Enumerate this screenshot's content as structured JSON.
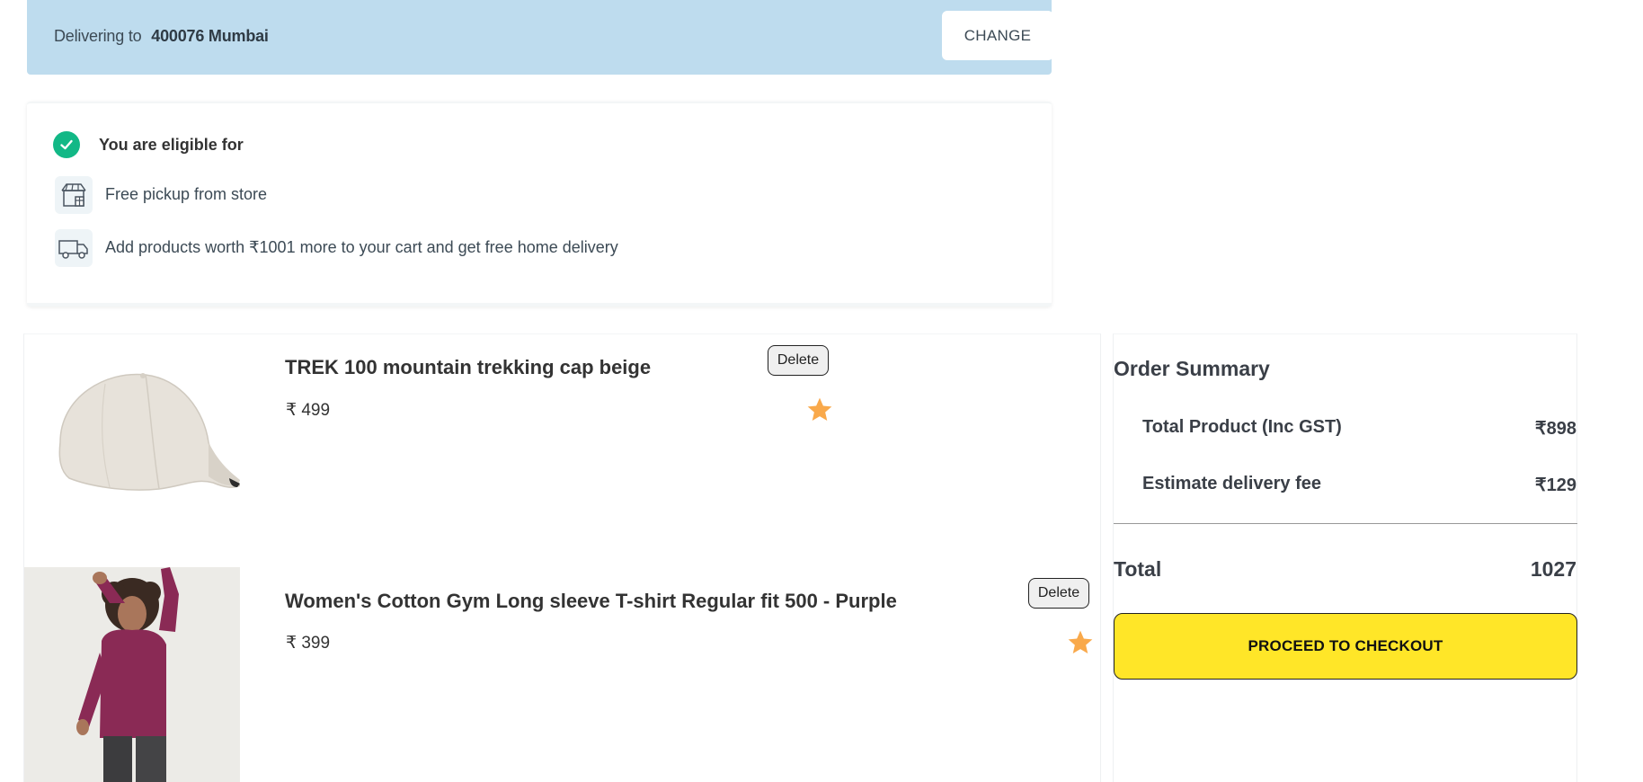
{
  "delivery": {
    "prefix": "Delivering to",
    "location": "400076 Mumbai",
    "change_label": "CHANGE"
  },
  "eligibility": {
    "title": "You are eligible for",
    "items": [
      {
        "icon": "store-pickup-icon",
        "text": "Free pickup from store"
      },
      {
        "icon": "delivery-truck-icon",
        "text": "Add products worth ₹1001 more to your cart and get free home delivery"
      }
    ]
  },
  "cart": {
    "items": [
      {
        "title": "TREK 100 mountain trekking cap beige",
        "price": "₹ 499",
        "delete_label": "Delete",
        "image_icon": "cap-image"
      },
      {
        "title": "Women's Cotton Gym Long sleeve T-shirt Regular fit 500 - Purple",
        "price": "₹ 399",
        "delete_label": "Delete",
        "image_icon": "tshirt-model-image"
      }
    ]
  },
  "summary": {
    "title": "Order Summary",
    "rows": [
      {
        "label": "Total Product (Inc GST)",
        "value": "₹898"
      },
      {
        "label": "Estimate delivery fee",
        "value": "₹129"
      }
    ],
    "total_label": "Total",
    "total_value": "1027",
    "checkout_label": "PROCEED TO CHECKOUT"
  },
  "colors": {
    "banner_bg": "#bedcee",
    "check_green": "#12b886",
    "star_orange": "#f9a94b",
    "checkout_yellow": "#ffe628"
  }
}
